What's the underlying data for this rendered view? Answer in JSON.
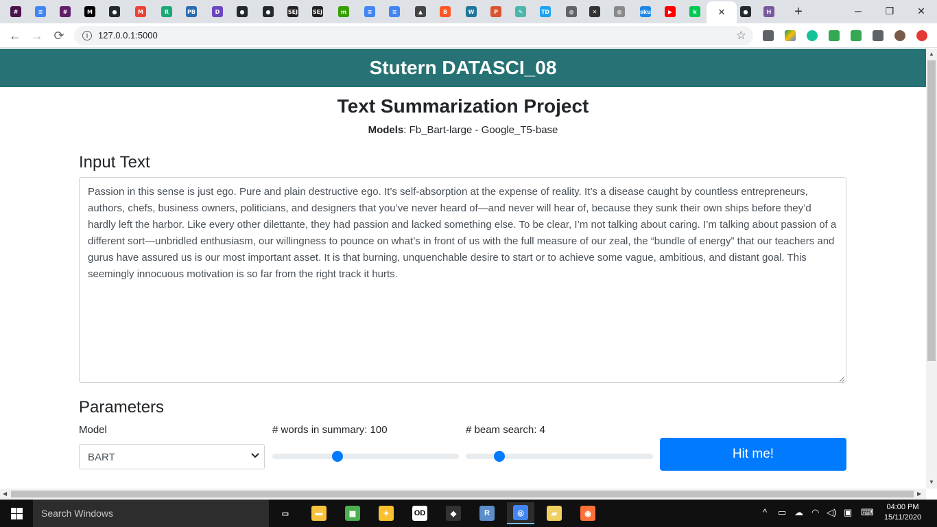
{
  "browser": {
    "tabs": [
      {
        "icon": "slack-icon",
        "color": "#4a154b",
        "glyph": "#"
      },
      {
        "icon": "google-docs-icon",
        "color": "#4285f4",
        "glyph": "≡"
      },
      {
        "icon": "slack-icon",
        "color": "#611f69",
        "glyph": "#"
      },
      {
        "icon": "medium-icon",
        "color": "#000000",
        "glyph": "M"
      },
      {
        "icon": "github-icon",
        "color": "#24292e",
        "glyph": "●"
      },
      {
        "icon": "gmail-icon",
        "color": "#ea4335",
        "glyph": "M"
      },
      {
        "icon": "r-studio-icon",
        "color": "#19a974",
        "glyph": "R"
      },
      {
        "icon": "pb-icon",
        "color": "#2b6cb0",
        "glyph": "PB"
      },
      {
        "icon": "d-app-icon",
        "color": "#6b46c1",
        "glyph": "D"
      },
      {
        "icon": "github-icon",
        "color": "#24292e",
        "glyph": "●"
      },
      {
        "icon": "github-icon",
        "color": "#24292e",
        "glyph": "●"
      },
      {
        "icon": "sej-icon",
        "color": "#222222",
        "glyph": "SEJ"
      },
      {
        "icon": "sej-icon",
        "color": "#222222",
        "glyph": "SEJ"
      },
      {
        "icon": "upwork-icon",
        "color": "#37a000",
        "glyph": "m"
      },
      {
        "icon": "google-docs-icon",
        "color": "#4285f4",
        "glyph": "≡"
      },
      {
        "icon": "google-docs-icon",
        "color": "#4285f4",
        "glyph": "≡"
      },
      {
        "icon": "image-icon",
        "color": "#444444",
        "glyph": "▲"
      },
      {
        "icon": "blogger-icon",
        "color": "#ff5722",
        "glyph": "B"
      },
      {
        "icon": "wordpress-icon",
        "color": "#21759b",
        "glyph": "W"
      },
      {
        "icon": "producthunt-icon",
        "color": "#da552f",
        "glyph": "P"
      },
      {
        "icon": "notes-icon",
        "color": "#4db6ac",
        "glyph": "✎"
      },
      {
        "icon": "td-icon",
        "color": "#1da1f2",
        "glyph": "TD"
      },
      {
        "icon": "globe-icon",
        "color": "#5f6368",
        "glyph": "◍"
      },
      {
        "icon": "x-icon",
        "color": "#333333",
        "glyph": "✕"
      },
      {
        "icon": "globe-icon",
        "color": "#888888",
        "glyph": "◍"
      },
      {
        "icon": "sku-icon",
        "color": "#1e88e5",
        "glyph": "sku"
      },
      {
        "icon": "youtube-icon",
        "color": "#ff0000",
        "glyph": "▶"
      },
      {
        "icon": "streamlit-icon",
        "color": "#00c853",
        "glyph": "k"
      },
      {
        "icon": "close-icon",
        "color": "#ffffff",
        "glyph": "✕"
      },
      {
        "icon": "github-icon",
        "color": "#24292e",
        "glyph": "●"
      },
      {
        "icon": "heroku-icon",
        "color": "#79589f",
        "glyph": "H"
      }
    ],
    "new_tab": "+",
    "window_controls": {
      "minimize": "─",
      "maximize": "❐",
      "close": "✕"
    },
    "url": "127.0.0.1:5000",
    "back": "←",
    "forward": "→",
    "reload": "⟳"
  },
  "page": {
    "header": "Stutern DATASCI_08",
    "title": "Text Summarization Project",
    "models_label": "Models",
    "models_value": ": Fb_Bart-large - Google_T5-base",
    "input_heading": "Input Text",
    "input_text": "Passion in this sense is just ego. Pure and plain destructive ego. It’s self-absorption at the expense of reality. It’s a disease caught by countless entrepreneurs, authors, chefs, business owners, politicians, and designers that you’ve never heard of—and never will hear of, because they sunk their own ships before they’d hardly left the harbor. Like every other dilettante, they had passion and lacked something else. To be clear, I’m not talking about caring. I’m talking about passion of a different sort—unbridled enthusiasm, our willingness to pounce on what’s in front of us with the full measure of our zeal, the “bundle of energy” that our teachers and gurus have assured us is our most important asset. It is that burning, unquenchable desire to start or to achieve some vague, ambitious, and distant goal. This seemingly innocuous motivation is so far from the right track it hurts.",
    "params_heading": "Parameters",
    "model_label": "Model",
    "model_value": "BART",
    "words_label": "# words in summary: 100",
    "words_fraction": 0.35,
    "beam_label": "# beam search: 4",
    "beam_fraction": 0.18,
    "submit_label": "Hit me!"
  },
  "taskbar": {
    "search_placeholder": "Search Windows",
    "apps": [
      {
        "name": "task-view-icon",
        "color": "#101010",
        "glyph": "▭",
        "running": false
      },
      {
        "name": "file-explorer-icon",
        "color": "#f9c23c",
        "glyph": "▬",
        "running": false
      },
      {
        "name": "spreadsheet-app-icon",
        "color": "#4caf50",
        "glyph": "▦",
        "running": false
      },
      {
        "name": "lightbulb-app-icon",
        "color": "#fbc02d",
        "glyph": "✦",
        "running": false
      },
      {
        "name": "open-diari-icon",
        "color": "#ffffff",
        "glyph": "OD",
        "running": false
      },
      {
        "name": "git-icon",
        "color": "#333333",
        "glyph": "◆",
        "running": false
      },
      {
        "name": "r-icon",
        "color": "#5b8fc9",
        "glyph": "R",
        "running": false
      },
      {
        "name": "chrome-icon",
        "color": "#4285f4",
        "glyph": "◎",
        "running": true
      },
      {
        "name": "folder-icon",
        "color": "#f0d060",
        "glyph": "▰",
        "running": false
      },
      {
        "name": "firefox-icon",
        "color": "#ff7139",
        "glyph": "◉",
        "running": false
      }
    ],
    "tray": [
      "^",
      "▭",
      "☁",
      "◠",
      "◁)",
      "▣",
      "⌨"
    ],
    "time": "04:00 PM",
    "date": "15/11/2020"
  }
}
